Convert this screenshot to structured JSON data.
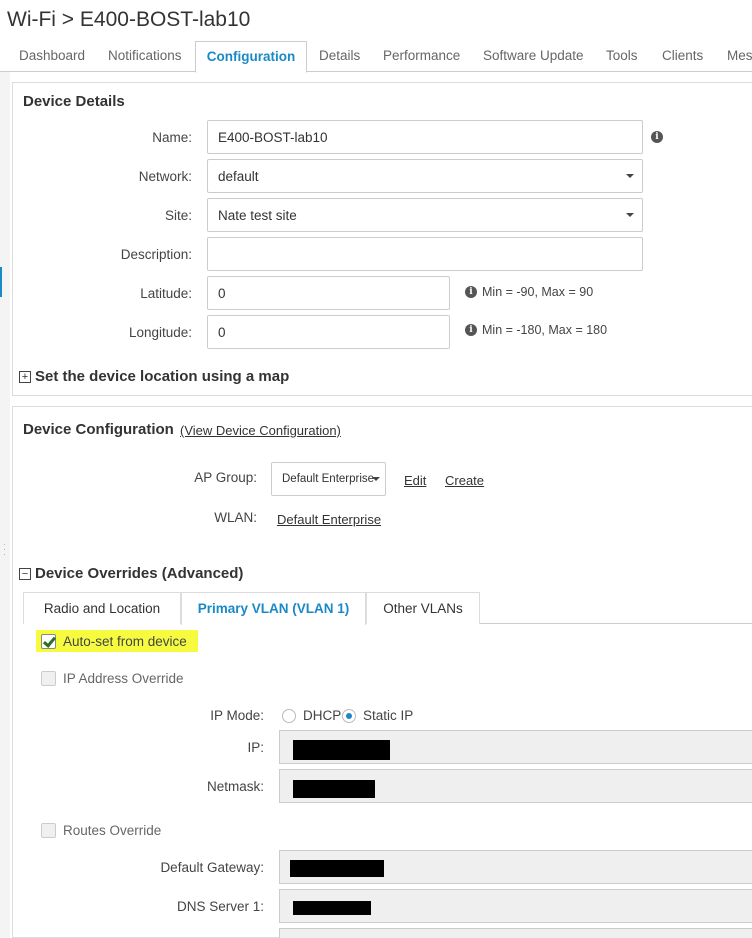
{
  "header": {
    "title": "Wi-Fi > E400-BOST-lab10"
  },
  "tabs": [
    "Dashboard",
    "Notifications",
    "Configuration",
    "Details",
    "Performance",
    "Software Update",
    "Tools",
    "Clients",
    "Mesh"
  ],
  "device_details": {
    "title": "Device Details",
    "name_label": "Name:",
    "name_value": "E400-BOST-lab10",
    "network_label": "Network:",
    "network_value": "default",
    "site_label": "Site:",
    "site_value": "Nate test site",
    "description_label": "Description:",
    "description_value": "",
    "latitude_label": "Latitude:",
    "latitude_value": "0",
    "latitude_hint": "Min = -90, Max = 90",
    "longitude_label": "Longitude:",
    "longitude_value": "0",
    "longitude_hint": "Min = -180, Max = 180",
    "map_toggle": "Set the device location using a map"
  },
  "device_configuration": {
    "title": "Device Configuration",
    "view_link": "(View Device Configuration)",
    "ap_group_label": "AP Group:",
    "ap_group_value": "Default Enterprise",
    "edit_link": "Edit",
    "create_link": "Create",
    "wlan_label": "WLAN:",
    "wlan_link": "Default Enterprise"
  },
  "overrides": {
    "title": "Device Overrides (Advanced)",
    "tabs": [
      "Radio and Location",
      "Primary VLAN (VLAN 1)",
      "Other VLANs"
    ],
    "auto_set_label": "Auto-set from device",
    "ip_override_label": "IP Address Override",
    "ip_mode_label": "IP Mode:",
    "dhcp_label": "DHCP",
    "static_label": "Static IP",
    "ip_label": "IP:",
    "netmask_label": "Netmask:",
    "routes_override_label": "Routes Override",
    "gateway_label": "Default Gateway:",
    "dns1_label": "DNS Server 1:"
  },
  "icons": {
    "info": "info-icon",
    "expand": "plus-box-icon",
    "collapse": "minus-box-icon",
    "checkbox": "check-icon"
  },
  "colors": {
    "accent": "#1a8ac6",
    "highlight": "#f6fb3f"
  }
}
